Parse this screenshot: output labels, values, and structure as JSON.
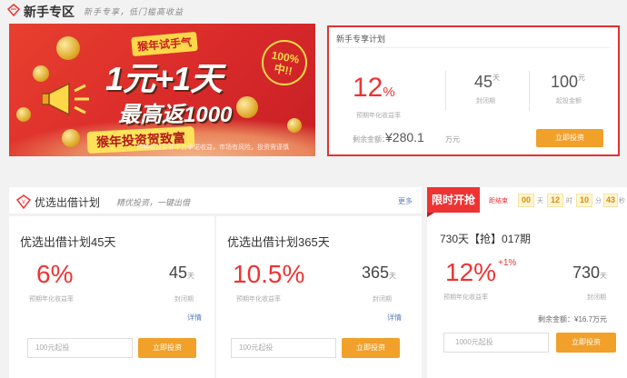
{
  "header": {
    "title": "新手专区",
    "slogan": "新手专享，低门槛高收益"
  },
  "banner": {
    "badge": "猴年试手气",
    "big_text": "1元+1天",
    "mid_text": "最高返1000",
    "ribbon": "猴年投资贺致富",
    "stamp": "100% 中!!",
    "note": "预期收益并非平台承诺收益，市场有风险，投资需谨慎"
  },
  "newbie_plan": {
    "title": "新手专享计划",
    "rate_value": "12",
    "rate_unit": "%",
    "rate_label": "预期年化收益率",
    "days_value": "45",
    "days_unit": "天",
    "days_label": "封闭期",
    "amount_value": "100",
    "amount_unit": "元",
    "amount_label": "起投金额",
    "remaining_label": "剩余金额：",
    "remaining_value": "¥280.1",
    "remaining_unit": "万元",
    "button": "立即投资"
  },
  "preferred": {
    "title": "优选出借计划",
    "slogan": "精优投资，一键出借",
    "more": "更多",
    "cards": [
      {
        "title": "优选出借计划45天",
        "rate": "6%",
        "rate_label": "预期年化收益率",
        "days": "45",
        "days_unit": "天",
        "days_label": "封闭期",
        "detail": "详情",
        "input_placeholder": "100元起投",
        "button": "立即投资"
      },
      {
        "title": "优选出借计划365天",
        "rate": "10.5%",
        "rate_label": "预期年化收益率",
        "days": "365",
        "days_unit": "天",
        "days_label": "封闭期",
        "detail": "详情",
        "input_placeholder": "100元起投",
        "button": "立即投资"
      }
    ]
  },
  "flash_sale": {
    "tag": "限时开抢",
    "countdown_label": "距结束",
    "countdown": {
      "days": "00",
      "days_unit": "天",
      "hours": "12",
      "hours_unit": "时",
      "minutes": "10",
      "minutes_unit": "分",
      "seconds": "43",
      "seconds_unit": "秒"
    },
    "title": "730天【抢】017期",
    "rate": "12%",
    "bonus": "+1%",
    "rate_label": "预期年化收益率",
    "days": "730",
    "days_unit": "天",
    "days_label": "封闭期",
    "remaining": "剩余金额：¥16.7万元",
    "input_placeholder": "1000元起投",
    "button": "立即投资"
  },
  "colors": {
    "accent_red": "#e33333",
    "button_orange": "#f1a02a",
    "link_blue": "#5b7fbf"
  }
}
